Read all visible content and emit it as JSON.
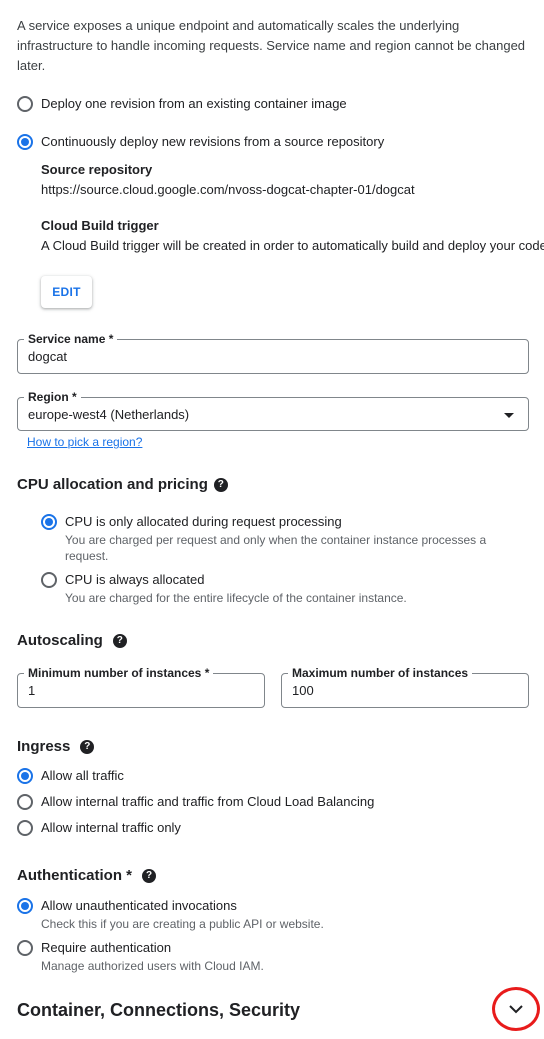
{
  "intro": "A service exposes a unique endpoint and automatically scales the underlying infrastructure to handle incoming requests. Service name and region cannot be changed later.",
  "deploy": {
    "option_existing": "Deploy one revision from an existing container image",
    "option_source": "Continuously deploy new revisions from a source repository",
    "source_repo_label": "Source repository",
    "source_repo_url": "https://source.cloud.google.com/nvoss-dogcat-chapter-01/dogcat",
    "trigger_label": "Cloud Build trigger",
    "trigger_text": "A Cloud Build trigger will be created in order to automatically build and deploy your code",
    "edit_label": "EDIT"
  },
  "service_name": {
    "label": "Service name *",
    "value": "dogcat"
  },
  "region": {
    "label": "Region *",
    "value": "europe-west4 (Netherlands)",
    "help_link": "How to pick a region?"
  },
  "cpu": {
    "heading": "CPU allocation and pricing",
    "option_request": "CPU is only allocated during request processing",
    "option_request_desc": "You are charged per request and only when the container instance processes a request.",
    "option_always": "CPU is always allocated",
    "option_always_desc": "You are charged for the entire lifecycle of the container instance."
  },
  "autoscaling": {
    "heading": "Autoscaling",
    "min_label": "Minimum number of instances *",
    "min_value": "1",
    "max_label": "Maximum number of instances",
    "max_value": "100"
  },
  "ingress": {
    "heading": "Ingress",
    "option_all": "Allow all traffic",
    "option_internal_lb": "Allow internal traffic and traffic from Cloud Load Balancing",
    "option_internal": "Allow internal traffic only"
  },
  "authentication": {
    "heading": "Authentication *",
    "option_unauth": "Allow unauthenticated invocations",
    "option_unauth_desc": "Check this if you are creating a public API or website.",
    "option_require": "Require authentication",
    "option_require_desc": "Manage authorized users with Cloud IAM."
  },
  "advanced": {
    "title": "Container, Connections, Security"
  },
  "icons": {
    "help": "help-icon",
    "dropdown": "dropdown-arrow-icon",
    "expand": "chevron-down-icon"
  },
  "colors": {
    "accent": "#1a73e8",
    "highlight_circle": "#e81b1b"
  }
}
